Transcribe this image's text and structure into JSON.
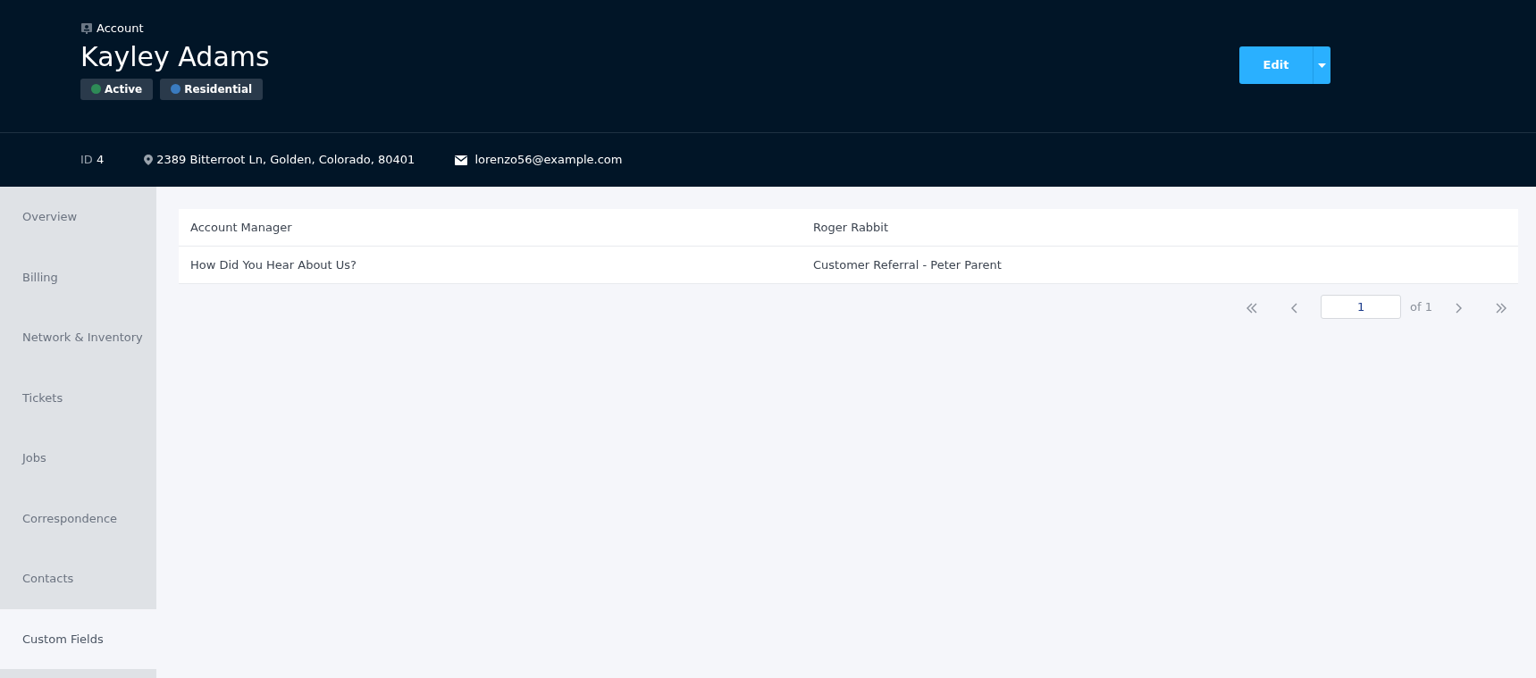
{
  "header": {
    "kicker": "Account",
    "title": "Kayley Adams",
    "badges": [
      {
        "label": "Active",
        "color": "#2e8b57"
      },
      {
        "label": "Residential",
        "color": "#3a7bbf"
      }
    ],
    "edit_button": "Edit"
  },
  "info_bar": {
    "id_label": "ID",
    "id_value": "4",
    "address": "2389 Bitterroot Ln, Golden, Colorado, 80401",
    "email": "lorenzo56@example.com"
  },
  "sidebar": {
    "items": [
      {
        "label": "Overview",
        "selected": false
      },
      {
        "label": "Billing",
        "selected": false
      },
      {
        "label": "Network & Inventory",
        "selected": false
      },
      {
        "label": "Tickets",
        "selected": false
      },
      {
        "label": "Jobs",
        "selected": false
      },
      {
        "label": "Correspondence",
        "selected": false
      },
      {
        "label": "Contacts",
        "selected": false
      },
      {
        "label": "Custom Fields",
        "selected": true
      }
    ]
  },
  "table": {
    "rows": [
      {
        "field": "Account Manager",
        "value": "Roger Rabbit"
      },
      {
        "field": "How Did You Hear About Us?",
        "value": "Customer Referral - Peter Parent"
      }
    ]
  },
  "pagination": {
    "page": "1",
    "of_label": "of 1"
  }
}
